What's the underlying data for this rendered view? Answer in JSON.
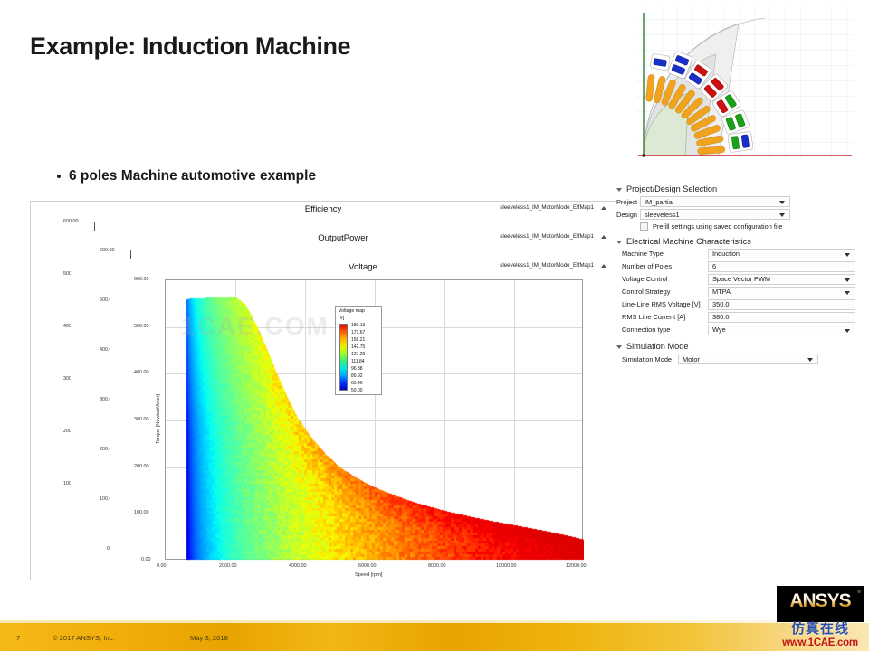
{
  "slide": {
    "title": "Example: Induction Machine",
    "bullet": "6 poles Machine automotive example"
  },
  "motor_image": {
    "caption": "induction-machine-quarter-cross-section"
  },
  "chart_windows": [
    {
      "title": "Efficiency",
      "tag": "sleeveless1_IM_MotorMode_EffMap1"
    },
    {
      "title": "OutputPower",
      "tag": "sleeveless1_IM_MotorMode_EffMap1"
    },
    {
      "title": "Voltage",
      "tag": "sleeveless1_IM_MotorMode_EffMap1"
    }
  ],
  "legend": {
    "title": "Voltage map",
    "unit": "[V]",
    "values": [
      "189.13",
      "173.67",
      "158.21",
      "142.75",
      "127.29",
      "111.84",
      "96.38",
      "80.92",
      "65.46",
      "50.00"
    ]
  },
  "watermark_chart": "1CAE.COM",
  "chart_data": {
    "type": "heatmap",
    "title": "Voltage",
    "series_name": "sleeveless1_IM_MotorMode_EffMap1",
    "xlabel": "Speed [rpm]",
    "ylabel": "Torque [NewtonMeter]",
    "xlim": [
      0,
      12000
    ],
    "ylim": [
      0,
      600
    ],
    "xticks": [
      "0.00",
      "2000.00",
      "4000.00",
      "6000.00",
      "8000.00",
      "10000.00",
      "12000.00"
    ],
    "yticks": [
      "0.00",
      "100.00",
      "200.00",
      "300.00",
      "400.00",
      "500.00",
      "600.00"
    ],
    "grid": true,
    "colorbar": {
      "label": "Voltage map",
      "unit": "[V]",
      "min": 50.0,
      "max": 189.13,
      "ticks": [
        189.13,
        173.67,
        158.21,
        142.75,
        127.29,
        111.84,
        96.38,
        80.92,
        65.46,
        50.0
      ],
      "colormap": "jet"
    },
    "envelope": {
      "comment": "Torque-speed operating envelope of the voltage map, [speed_rpm, max_torque_Nm]",
      "points": [
        [
          600,
          560
        ],
        [
          1000,
          562
        ],
        [
          1500,
          563
        ],
        [
          2000,
          565
        ],
        [
          2300,
          548
        ],
        [
          2600,
          505
        ],
        [
          2900,
          455
        ],
        [
          3200,
          400
        ],
        [
          3500,
          350
        ],
        [
          3800,
          305
        ],
        [
          4200,
          262
        ],
        [
          4600,
          228
        ],
        [
          5000,
          200
        ],
        [
          5500,
          176
        ],
        [
          6000,
          157
        ],
        [
          6500,
          142
        ],
        [
          7000,
          128
        ],
        [
          7500,
          117
        ],
        [
          8000,
          107
        ],
        [
          8500,
          98
        ],
        [
          9000,
          90
        ],
        [
          9500,
          83
        ],
        [
          10000,
          76
        ],
        [
          10500,
          69
        ],
        [
          11000,
          62
        ],
        [
          11500,
          54
        ],
        [
          12000,
          45
        ]
      ]
    },
    "field_note": "Voltage increases with speed: deep blue (50 V) near stall, through cyan/green mid-speed, to red (189 V) at high speed / field-weakening region."
  },
  "panel": {
    "sections": [
      {
        "id": "project-design-selection",
        "title": "Project/Design Selection",
        "fields": [
          {
            "label": "Project",
            "value": "IM_partial",
            "type": "dropdown"
          },
          {
            "label": "Design",
            "value": "sleeveless1",
            "type": "dropdown"
          }
        ],
        "checkbox": {
          "label": "Prefill settings using saved configuration file",
          "checked": false
        }
      },
      {
        "id": "electrical-machine-characteristics",
        "title": "Electrical Machine Characteristics",
        "fields": [
          {
            "label": "Machine Type",
            "value": "Induction",
            "type": "dropdown"
          },
          {
            "label": "Number of Poles",
            "value": "6",
            "type": "text"
          },
          {
            "label": "Voltage Control",
            "value": "Space Vector PWM",
            "type": "dropdown"
          },
          {
            "label": "Control Strategy",
            "value": "MTPA",
            "type": "dropdown"
          },
          {
            "label": "Line-Line RMS Voltage [V]",
            "value": "350.0",
            "type": "text"
          },
          {
            "label": "RMS Line Current [A]",
            "value": "380.0",
            "type": "text"
          },
          {
            "label": "Connection type",
            "value": "Wye",
            "type": "dropdown"
          }
        ]
      },
      {
        "id": "simulation-mode",
        "title": "Simulation Mode",
        "fields": [
          {
            "label": "Simulation Mode",
            "value": "Motor",
            "type": "dropdown"
          }
        ]
      }
    ]
  },
  "footer": {
    "page": "7",
    "copyright": "© 2017 ANSYS, Inc.",
    "date": "May 3, 2018"
  },
  "branding": {
    "logo": "ANSYS",
    "trademark": "®",
    "watermark_cn": "仿真在线",
    "watermark_url": "www.1CAE.com"
  }
}
